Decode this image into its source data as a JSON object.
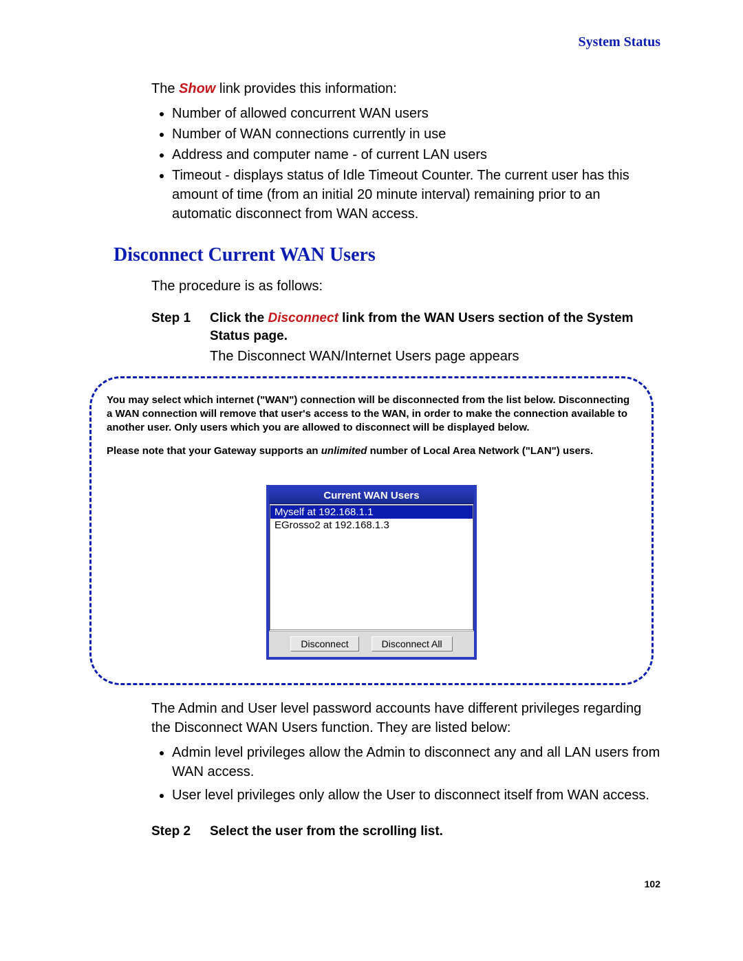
{
  "header": {
    "section_title": "System Status"
  },
  "intro": {
    "prefix": "The ",
    "link_word": "Show",
    "suffix": " link provides this information:"
  },
  "show_bullets": [
    "Number of allowed concurrent WAN users",
    "Number of WAN connections currently in use",
    "Address and computer name - of current LAN users",
    "Timeout - displays status of Idle Timeout Counter. The current user has this amount of time (from an initial 20 minute interval) remaining prior to an automatic disconnect from WAN access."
  ],
  "section_heading": "Disconnect Current WAN Users",
  "procedure_intro": "The procedure is as follows:",
  "step1": {
    "label": "Step 1",
    "instr_prefix": "Click the ",
    "instr_link": "Disconnect",
    "instr_suffix": " link from the WAN Users section of the System Status page.",
    "result": "The Disconnect WAN/Internet Users page appears"
  },
  "callout": {
    "para1": "You may select which internet (\"WAN\") connection will be disconnected from the list below. Disconnecting a WAN connection will remove that user's access to the WAN, in order to make the connection available to another user. Only users which you are allowed to disconnect will be displayed below.",
    "note_prefix": "Please note that your Gateway supports an ",
    "note_em": "unlimited",
    "note_suffix": " number of Local Area Network (\"LAN\") users."
  },
  "gateway": {
    "title": "Current WAN Users",
    "items": [
      {
        "label": "Myself at 192.168.1.1",
        "selected": true
      },
      {
        "label": "EGrosso2 at 192.168.1.3",
        "selected": false
      }
    ],
    "btn_disconnect": "Disconnect",
    "btn_disconnect_all": "Disconnect All"
  },
  "post_callout": "The Admin and User level password accounts have different privileges regarding the Disconnect WAN Users function. They are listed below:",
  "privilege_bullets": [
    "Admin level privileges allow the Admin to disconnect any and all LAN users from WAN access.",
    "User level privileges only allow the User to disconnect itself from WAN access."
  ],
  "step2": {
    "label": "Step 2",
    "instruction": "Select the user from the scrolling list."
  },
  "page_number": "102"
}
